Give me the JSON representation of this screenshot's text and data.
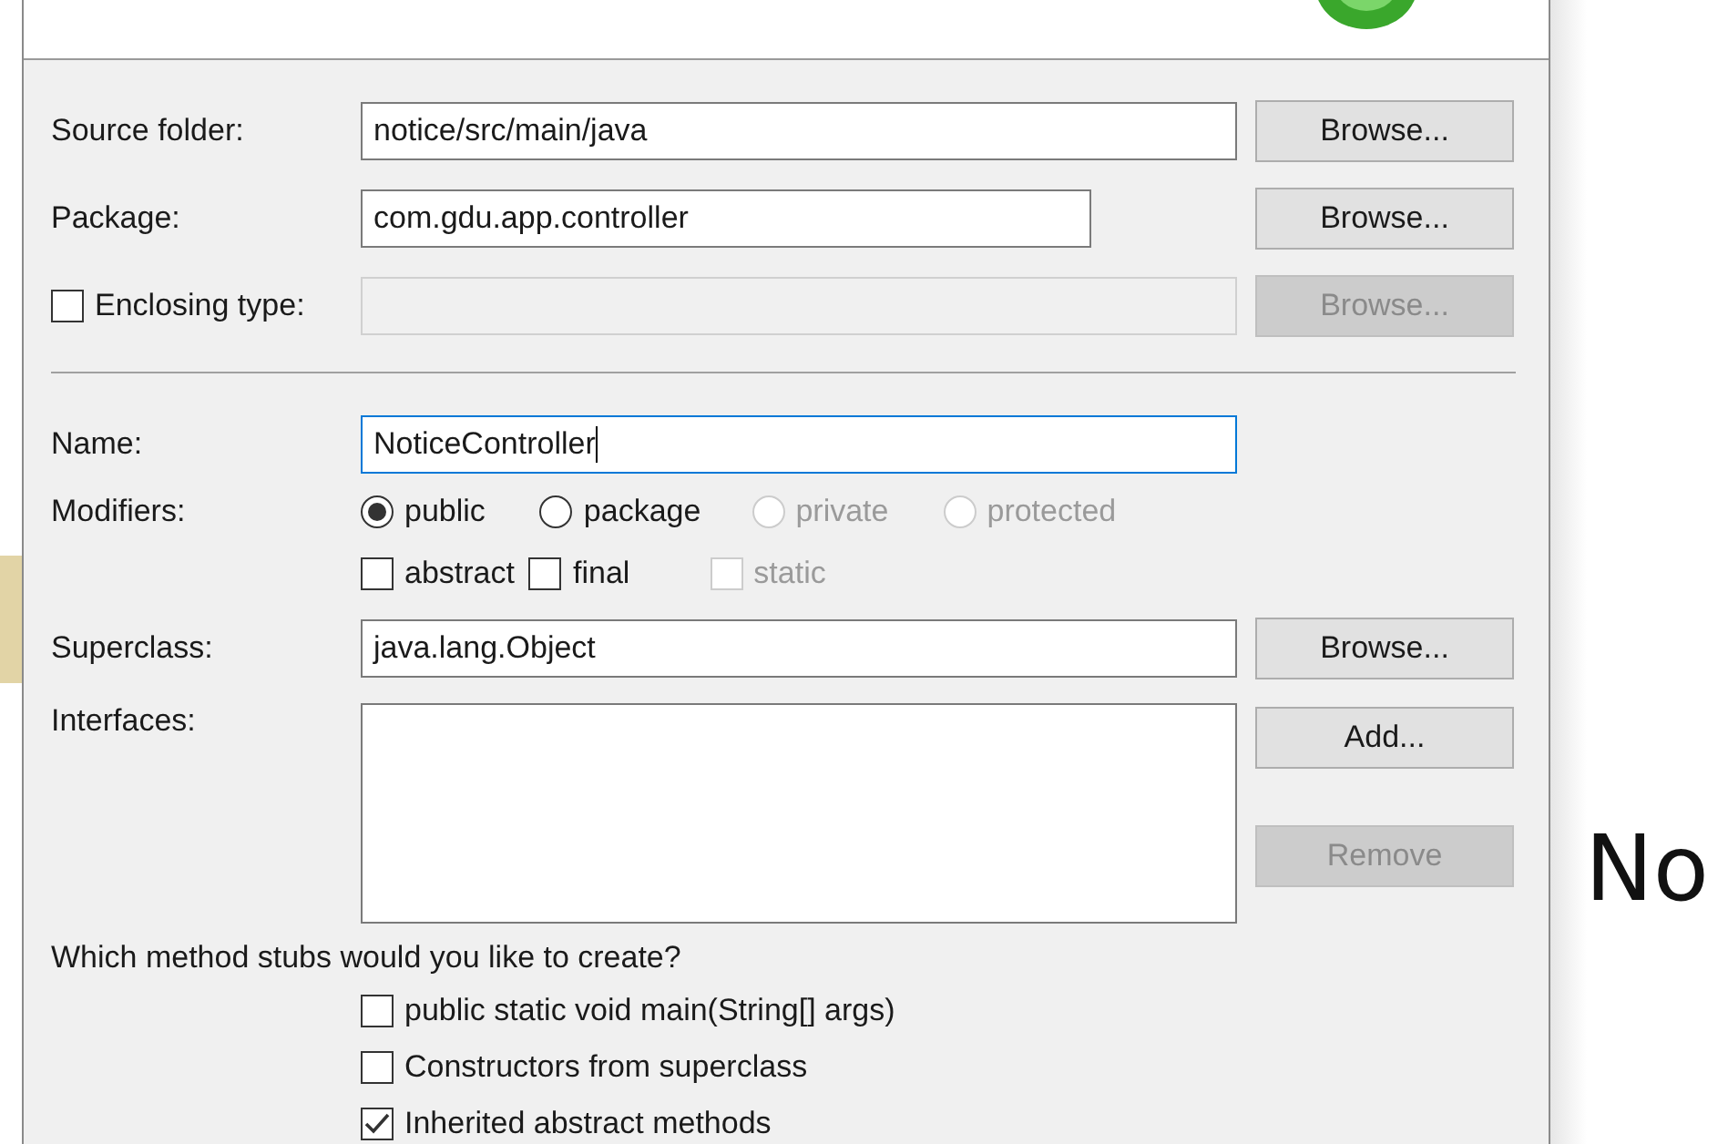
{
  "source_folder": {
    "label": "Source folder:",
    "value": "notice/src/main/java",
    "button": {
      "label": "Browse...",
      "disabled": false
    }
  },
  "package": {
    "label": "Package:",
    "value": "com.gdu.app.controller",
    "button": {
      "label": "Browse...",
      "disabled": false
    }
  },
  "enclosing_type": {
    "label": "Enclosing type:",
    "checked": false,
    "disabled": true,
    "button": {
      "label": "Browse...",
      "disabled": true
    }
  },
  "name": {
    "label": "Name:",
    "value": "NoticeController",
    "focused": true
  },
  "modifiers": {
    "label": "Modifiers:",
    "access": [
      {
        "label": "public",
        "selected": true,
        "disabled": false
      },
      {
        "label": "package",
        "selected": false,
        "disabled": false
      },
      {
        "label": "private",
        "selected": false,
        "disabled": true
      },
      {
        "label": "protected",
        "selected": false,
        "disabled": true
      }
    ],
    "flags": [
      {
        "label": "abstract",
        "checked": false,
        "disabled": false
      },
      {
        "label": "final",
        "checked": false,
        "disabled": false
      },
      {
        "label": "static",
        "checked": false,
        "disabled": true
      }
    ]
  },
  "superclass": {
    "label": "Superclass:",
    "value": "java.lang.Object",
    "button": {
      "label": "Browse...",
      "disabled": false
    }
  },
  "interfaces": {
    "label": "Interfaces:",
    "buttons": [
      {
        "label": "Add...",
        "disabled": false
      },
      {
        "label": "Remove",
        "disabled": true
      }
    ]
  },
  "method_stubs": {
    "prompt": "Which method stubs would you like to create?",
    "options": [
      {
        "label": "public static void main(String[] args)",
        "checked": false
      },
      {
        "label": "Constructors from superclass",
        "checked": false
      },
      {
        "label": "Inherited abstract methods",
        "checked": true
      }
    ]
  },
  "background": {
    "text": "No"
  }
}
